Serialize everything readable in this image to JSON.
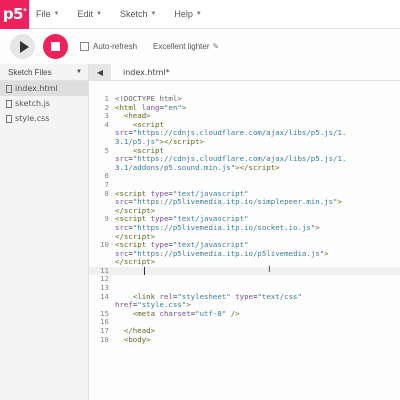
{
  "app": {
    "logo": "p5",
    "logo_sup": "*"
  },
  "menu": [
    {
      "label": "File"
    },
    {
      "label": "Edit"
    },
    {
      "label": "Sketch"
    },
    {
      "label": "Help"
    }
  ],
  "toolbar": {
    "autorefresh_label": "Auto-refresh",
    "project_name": "Excellent lighter"
  },
  "sidebar": {
    "title": "Sketch Files",
    "files": [
      {
        "name": "index.html",
        "selected": true
      },
      {
        "name": "sketch.js",
        "selected": false
      },
      {
        "name": "style.css",
        "selected": false
      }
    ]
  },
  "editor": {
    "tab_name": "index.html*",
    "collapse_glyph": "◀"
  },
  "code_lines": [
    {
      "num": "1",
      "html": "<span class=\"doctype\">&lt;!DOCTYPE html&gt;</span>"
    },
    {
      "num": "2",
      "html": "<span class=\"tag\">&lt;html</span> <span class=\"attr\">lang</span>=<span class=\"str\">\"en\"</span><span class=\"tag\">&gt;</span>"
    },
    {
      "num": "3",
      "html": "  <span class=\"tag\">&lt;head&gt;</span>"
    },
    {
      "num": "4",
      "html": "    <span class=\"tag\">&lt;script</span>"
    },
    {
      "num": "",
      "html": "<span class=\"attr\">src</span>=<span class=\"str\">\"https://cdnjs.cloudflare.com/ajax/libs/p5.js/1.</span>"
    },
    {
      "num": "",
      "html": "<span class=\"str\">3.1/p5.js\"</span><span class=\"tag\">&gt;&lt;/script&gt;</span>"
    },
    {
      "num": "5",
      "html": "    <span class=\"tag\">&lt;script</span>"
    },
    {
      "num": "",
      "html": "<span class=\"attr\">src</span>=<span class=\"str\">\"https://cdnjs.cloudflare.com/ajax/libs/p5.js/1.</span>"
    },
    {
      "num": "",
      "html": "<span class=\"str\">3.1/addons/p5.sound.min.js\"</span><span class=\"tag\">&gt;&lt;/script&gt;</span>"
    },
    {
      "num": "6",
      "html": ""
    },
    {
      "num": "7",
      "html": ""
    },
    {
      "num": "8",
      "html": "<span class=\"tag\">&lt;script</span> <span class=\"attr\">type</span>=<span class=\"str\">\"text/javascript\"</span>"
    },
    {
      "num": "",
      "html": "<span class=\"attr\">src</span>=<span class=\"str\">\"https://p5livemedia.itp.io/simplepeer.min.js\"</span><span class=\"tag\">&gt;</span>"
    },
    {
      "num": "",
      "html": "<span class=\"tag\">&lt;/script&gt;</span>"
    },
    {
      "num": "9",
      "html": "<span class=\"tag\">&lt;script</span> <span class=\"attr\">type</span>=<span class=\"str\">\"text/javascript\"</span>"
    },
    {
      "num": "",
      "html": "<span class=\"attr\">src</span>=<span class=\"str\">\"https://p5livemedia.itp.io/socket.io.js\"</span><span class=\"tag\">&gt;</span>"
    },
    {
      "num": "",
      "html": "<span class=\"tag\">&lt;/script&gt;</span>"
    },
    {
      "num": "10",
      "html": "<span class=\"tag\">&lt;script</span> <span class=\"attr\">type</span>=<span class=\"str\">\"text/javascript\"</span>"
    },
    {
      "num": "",
      "html": "<span class=\"attr\">src</span>=<span class=\"str\">\"https://p5livemedia.itp.io/p5livemedia.js\"</span><span class=\"tag\">&gt;</span>"
    },
    {
      "num": "",
      "html": "<span class=\"tag\">&lt;/script&gt;</span>"
    },
    {
      "num": "11",
      "html": "",
      "active": true
    },
    {
      "num": "12",
      "html": ""
    },
    {
      "num": "13",
      "html": ""
    },
    {
      "num": "14",
      "html": "    <span class=\"tag\">&lt;link</span> <span class=\"attr\">rel</span>=<span class=\"str\">\"stylesheet\"</span> <span class=\"attr\">type</span>=<span class=\"str\">\"text/css\"</span>"
    },
    {
      "num": "",
      "html": "<span class=\"attr\">href</span>=<span class=\"str\">\"style.css\"</span><span class=\"tag\">&gt;</span>"
    },
    {
      "num": "15",
      "html": "    <span class=\"tag\">&lt;meta</span> <span class=\"attr\">charset</span>=<span class=\"str\">\"utf-8\"</span> <span class=\"tag\">/&gt;</span>"
    },
    {
      "num": "16",
      "html": ""
    },
    {
      "num": "17",
      "html": "  <span class=\"tag\">&lt;/head&gt;</span>"
    },
    {
      "num": "18",
      "html": "  <span class=\"tag\">&lt;body&gt;</span>"
    }
  ]
}
